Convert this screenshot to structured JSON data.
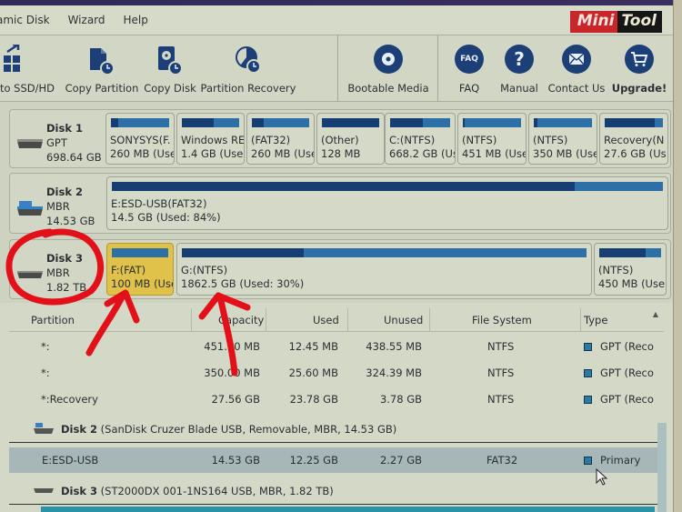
{
  "app": {
    "logo_part1": "Mini",
    "logo_part2": "Tool"
  },
  "menu": [
    {
      "label": "amic Disk"
    },
    {
      "label": "Wizard"
    },
    {
      "label": "Help"
    }
  ],
  "toolbar": {
    "migrate_label": "to SSD/HD",
    "copy_partition_label": "Copy Partition",
    "copy_disk_label": "Copy Disk",
    "partition_recovery_label": "Partition Recovery",
    "bootable_media_label": "Bootable Media",
    "faq_label": "FAQ",
    "faq_icon_text": "FAQ",
    "manual_label": "Manual",
    "manual_icon_text": "?",
    "contact_label": "Contact Us",
    "upgrade_label": "Upgrade!"
  },
  "disk_map": [
    {
      "name": "Disk 1",
      "type": "GPT",
      "size": "698.64 GB",
      "partitions": [
        {
          "label": "SONYSYS(F.",
          "size": "260 MB (Use",
          "used_fraction": 0.12
        },
        {
          "label": "Windows RE",
          "size": "1.4 GB (Use",
          "used_fraction": 0.55
        },
        {
          "label": "(FAT32)",
          "size": "260 MB (Use",
          "used_fraction": 0.2
        },
        {
          "label": "(Other)",
          "size": "128 MB",
          "used_fraction": 1.0
        },
        {
          "label": "C:(NTFS)",
          "size": "668.2 GB (Us",
          "used_fraction": 0.55
        },
        {
          "label": "(NTFS)",
          "size": "451 MB (Use",
          "used_fraction": 0.03
        },
        {
          "label": "(NTFS)",
          "size": "350 MB (Use",
          "used_fraction": 0.07
        },
        {
          "label": "Recovery(N",
          "size": "27.6 GB (Us",
          "used_fraction": 0.86
        }
      ]
    },
    {
      "name": "Disk 2",
      "type": "MBR",
      "size": "14.53 GB",
      "partitions": [
        {
          "label": "E:ESD-USB(FAT32)",
          "size": "14.5 GB (Used: 84%)",
          "used_fraction": 0.84
        }
      ]
    },
    {
      "name": "Disk 3",
      "type": "MBR",
      "size": "1.82 TB",
      "partitions": [
        {
          "label": "F:(FAT)",
          "size": "100 MB (Use",
          "used_fraction": 0.0,
          "selected": true
        },
        {
          "label": "G:(NTFS)",
          "size": "1862.5 GB (Used: 30%)",
          "used_fraction": 0.3
        },
        {
          "label": "(NTFS)",
          "size": "450 MB (Use",
          "used_fraction": 0.75
        }
      ]
    }
  ],
  "table": {
    "columns": [
      "Partition",
      "Capacity",
      "Used",
      "Unused",
      "File System",
      "Type"
    ],
    "disk1_rows": [
      {
        "partition": "*:",
        "capacity": "451.00 MB",
        "used": "12.45 MB",
        "unused": "438.55 MB",
        "fs": "NTFS",
        "type": "GPT (Reco"
      },
      {
        "partition": "*:",
        "capacity": "350.00 MB",
        "used": "25.60 MB",
        "unused": "324.39 MB",
        "fs": "NTFS",
        "type": "GPT (Reco"
      },
      {
        "partition": "*:Recovery",
        "capacity": "27.56 GB",
        "used": "23.78 GB",
        "unused": "3.78 GB",
        "fs": "NTFS",
        "type": "GPT (Reco"
      }
    ],
    "disk2_header": {
      "name": "Disk 2",
      "details": "(SanDisk Cruzer Blade USB, Removable, MBR, 14.53 GB)"
    },
    "disk2_rows": [
      {
        "partition": "E:ESD-USB",
        "capacity": "14.53 GB",
        "used": "12.25 GB",
        "unused": "2.27 GB",
        "fs": "FAT32",
        "type": "Primary"
      }
    ],
    "disk3_header": {
      "name": "Disk 3",
      "details": "(ST2000DX 001-1NS164 USB, MBR, 1.82 TB)"
    }
  },
  "colors": {
    "accent_blue": "#1d3f78",
    "bar_free": "#2d6fa7",
    "bar_used": "#163e72",
    "selected_partition": "#e0c24a",
    "annotation_red": "#e3101a"
  }
}
